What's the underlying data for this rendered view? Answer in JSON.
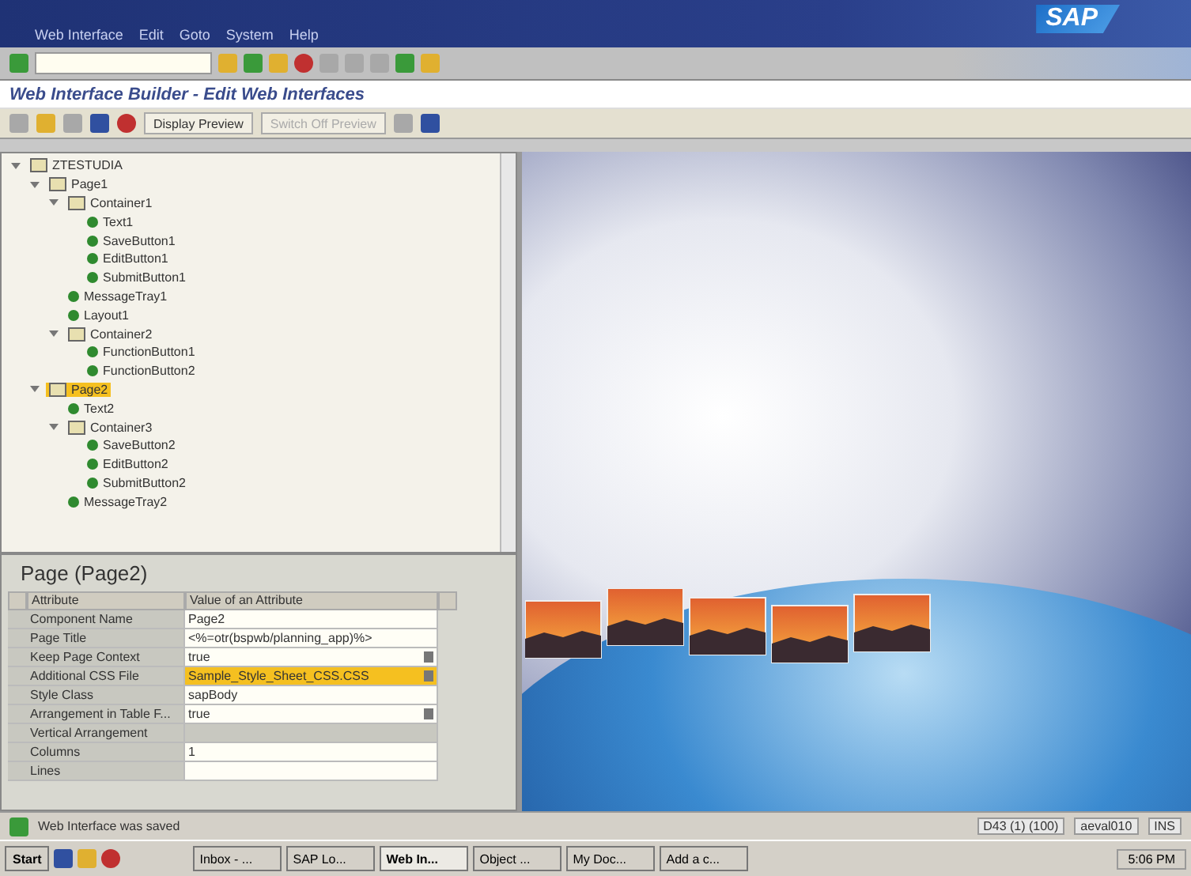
{
  "menu": [
    "Web Interface",
    "Edit",
    "Goto",
    "System",
    "Help"
  ],
  "logo": "SAP",
  "title": "Web Interface Builder - Edit Web Interfaces",
  "app_toolbar": {
    "buttons": [
      {
        "label": "Display Preview",
        "disabled": false
      },
      {
        "label": "Switch Off Preview",
        "disabled": true
      }
    ]
  },
  "tree": [
    {
      "label": "ZTESTUDIA",
      "kind": "folder",
      "expanded": true,
      "selected": false,
      "children": [
        {
          "label": "Page1",
          "kind": "folder",
          "expanded": true,
          "selected": false,
          "children": [
            {
              "label": "Container1",
              "kind": "folder",
              "expanded": true,
              "selected": false,
              "children": [
                {
                  "label": "Text1",
                  "kind": "element",
                  "selected": false
                },
                {
                  "label": "SaveButton1",
                  "kind": "element",
                  "selected": false
                },
                {
                  "label": "EditButton1",
                  "kind": "element",
                  "selected": false
                },
                {
                  "label": "SubmitButton1",
                  "kind": "element",
                  "selected": false
                }
              ]
            },
            {
              "label": "MessageTray1",
              "kind": "element",
              "selected": false
            },
            {
              "label": "Layout1",
              "kind": "element",
              "selected": false
            },
            {
              "label": "Container2",
              "kind": "folder",
              "expanded": true,
              "selected": false,
              "children": [
                {
                  "label": "FunctionButton1",
                  "kind": "element",
                  "selected": false
                },
                {
                  "label": "FunctionButton2",
                  "kind": "element",
                  "selected": false
                }
              ]
            }
          ]
        },
        {
          "label": "Page2",
          "kind": "folder",
          "expanded": true,
          "selected": true,
          "children": [
            {
              "label": "Text2",
              "kind": "element",
              "selected": false
            },
            {
              "label": "Container3",
              "kind": "folder",
              "expanded": true,
              "selected": false,
              "children": [
                {
                  "label": "SaveButton2",
                  "kind": "element",
                  "selected": false
                },
                {
                  "label": "EditButton2",
                  "kind": "element",
                  "selected": false
                },
                {
                  "label": "SubmitButton2",
                  "kind": "element",
                  "selected": false
                }
              ]
            },
            {
              "label": "MessageTray2",
              "kind": "element",
              "selected": false
            }
          ]
        }
      ]
    }
  ],
  "properties": {
    "title": "Page (Page2)",
    "columns": [
      "Attribute",
      "Value of an Attribute"
    ],
    "rows": [
      {
        "attribute": "Component Name",
        "value": "Page2",
        "selected": false,
        "disabled": false,
        "has_help": false
      },
      {
        "attribute": "Page Title",
        "value": "<%=otr(bspwb/planning_app)%>",
        "selected": false,
        "disabled": false,
        "has_help": false
      },
      {
        "attribute": "Keep Page Context",
        "value": "true",
        "selected": false,
        "disabled": false,
        "has_help": true
      },
      {
        "attribute": "Additional CSS File",
        "value": "Sample_Style_Sheet_CSS.CSS",
        "selected": true,
        "disabled": false,
        "has_help": true
      },
      {
        "attribute": "Style Class",
        "value": "sapBody",
        "selected": false,
        "disabled": false,
        "has_help": false
      },
      {
        "attribute": "Arrangement in Table F...",
        "value": "true",
        "selected": false,
        "disabled": false,
        "has_help": true
      },
      {
        "attribute": "Vertical Arrangement",
        "value": "",
        "selected": false,
        "disabled": true,
        "has_help": false
      },
      {
        "attribute": "Columns",
        "value": "1",
        "selected": false,
        "disabled": false,
        "has_help": false
      },
      {
        "attribute": "Lines",
        "value": "",
        "selected": false,
        "disabled": false,
        "has_help": false
      }
    ]
  },
  "status_bar": {
    "message": "Web Interface was saved",
    "system": "D43 (1) (100)",
    "server": "aeval010",
    "mode": "INS"
  },
  "taskbar": {
    "start": "Start",
    "tasks": [
      {
        "label": "Inbox - ...",
        "selected": false
      },
      {
        "label": "SAP Lo...",
        "selected": false
      },
      {
        "label": "Web In...",
        "selected": true
      },
      {
        "label": "Object ...",
        "selected": false
      },
      {
        "label": "My Doc...",
        "selected": false
      },
      {
        "label": "Add a c...",
        "selected": false
      }
    ],
    "time": "5:06 PM"
  }
}
